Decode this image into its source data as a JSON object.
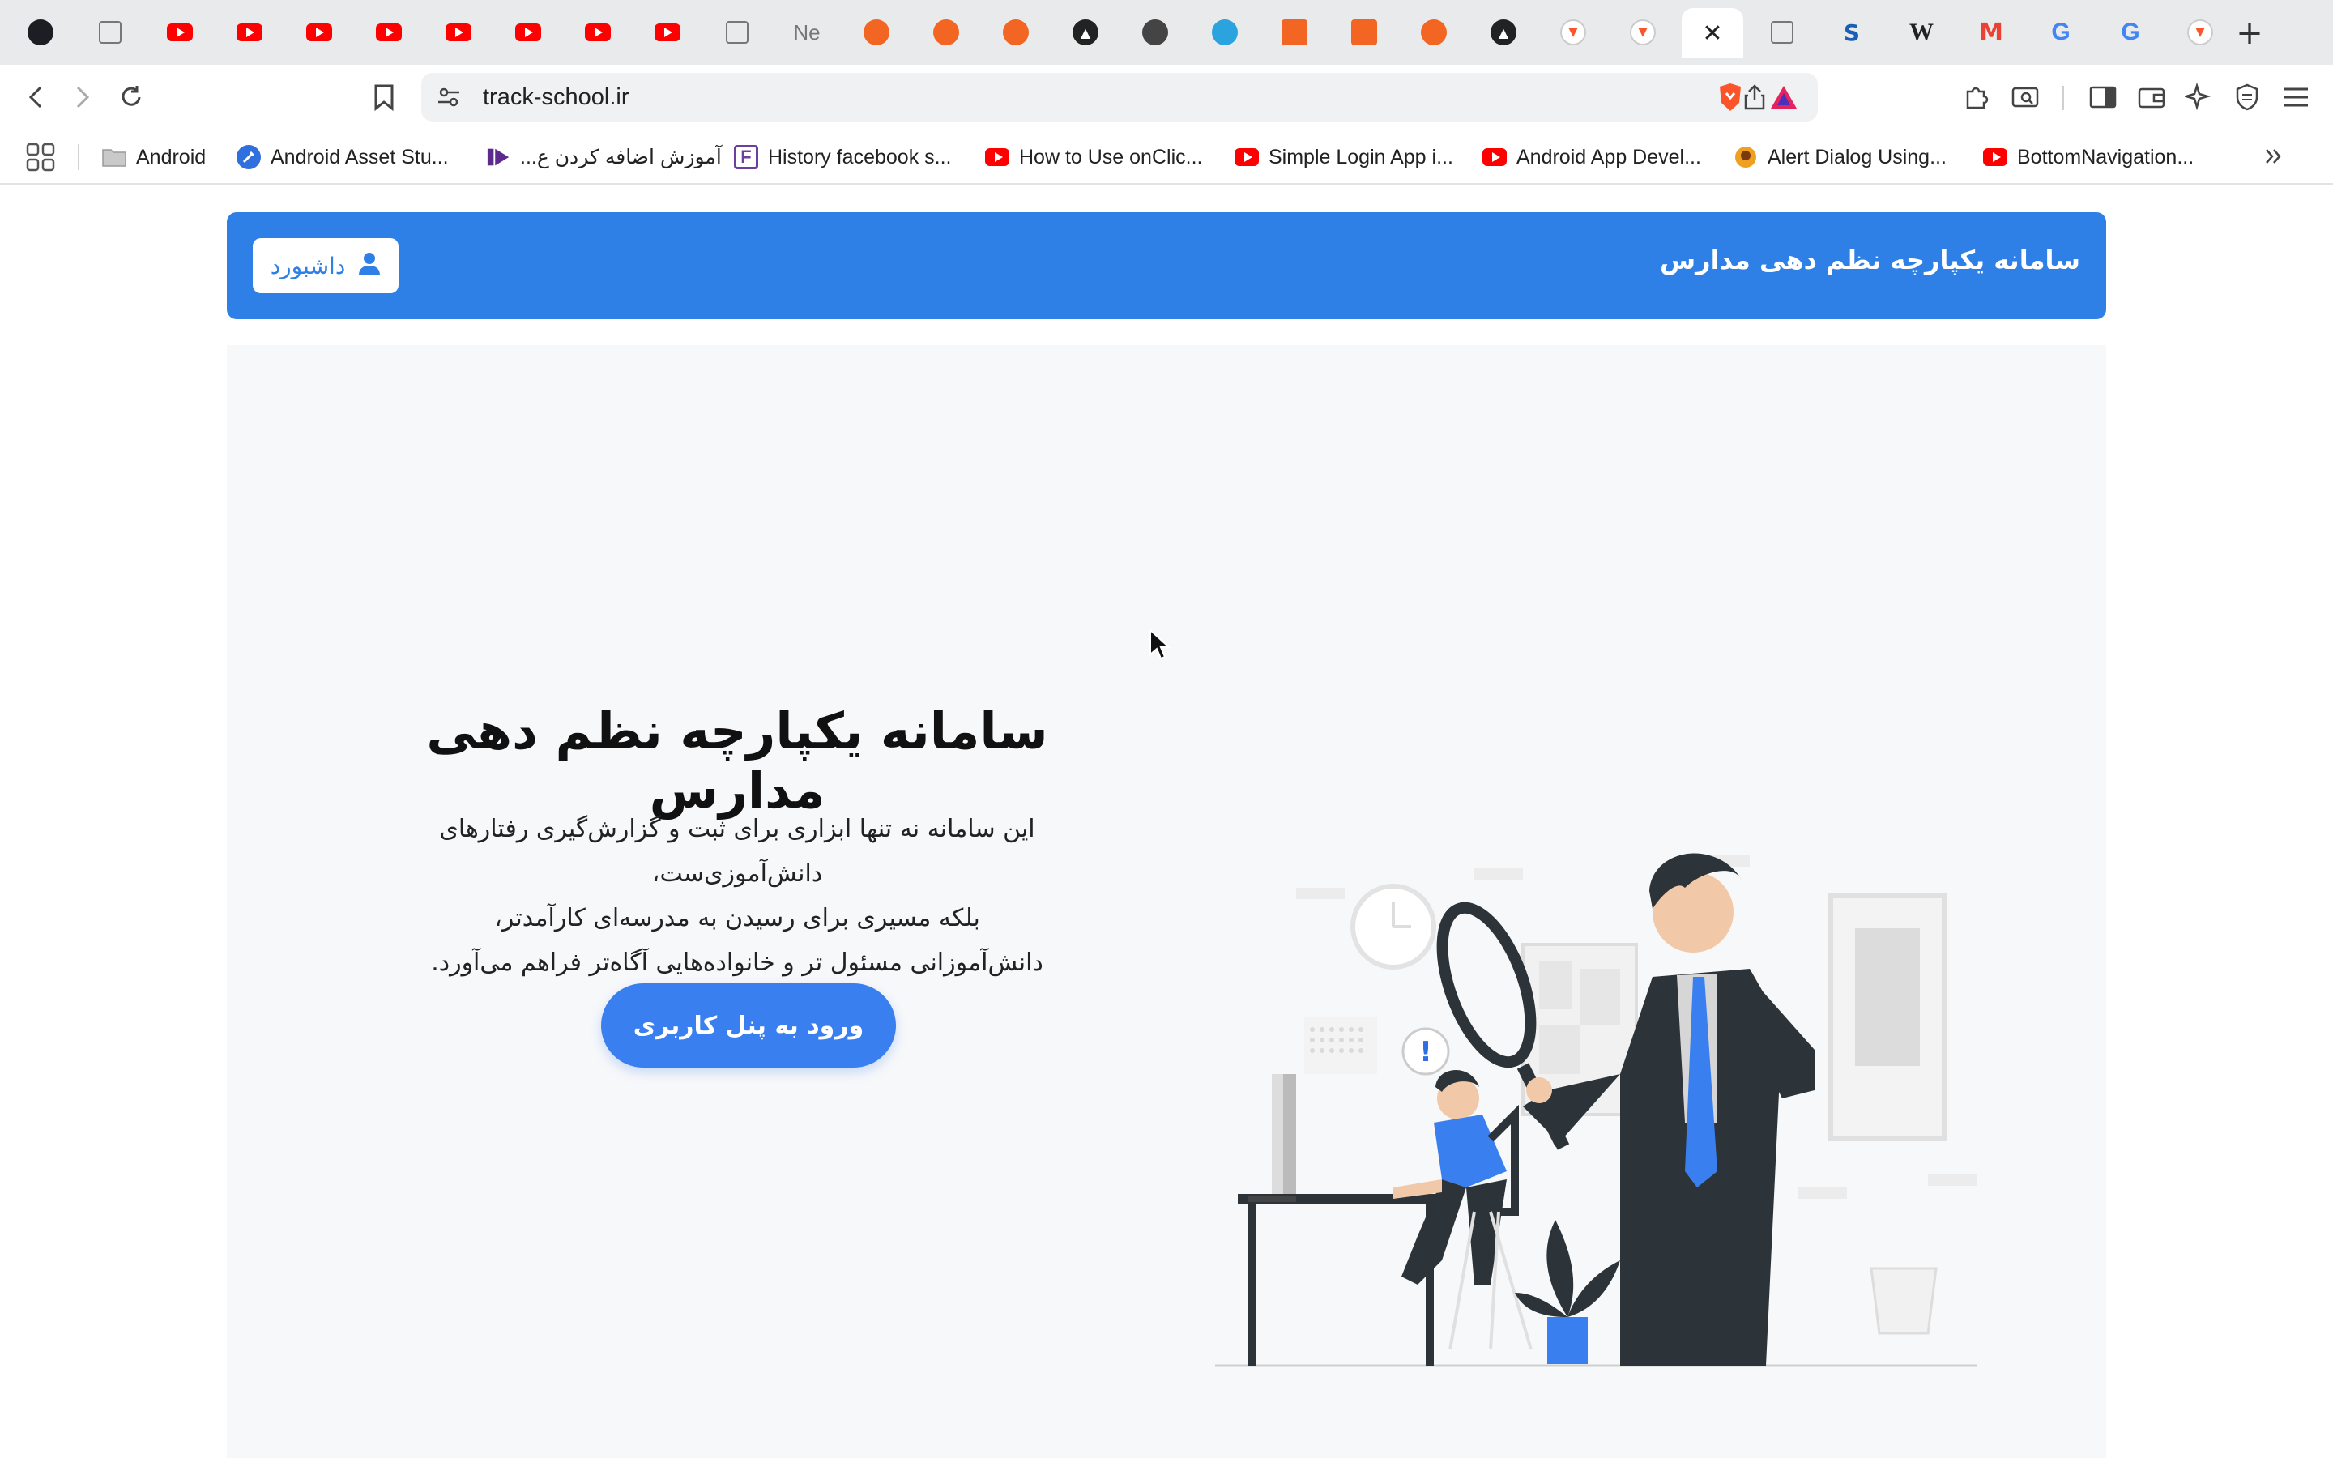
{
  "tabs": {
    "new_tab_text": "Ne",
    "active_close": "✕",
    "plus": "+",
    "items": [
      {
        "icon": "github-icon",
        "color": "#1b1f23"
      },
      {
        "icon": "reader-icon",
        "color": "#777777"
      },
      {
        "icon": "youtube-icon",
        "color": "#ff0000"
      },
      {
        "icon": "youtube-icon",
        "color": "#ff0000"
      },
      {
        "icon": "youtube-icon",
        "color": "#ff0000"
      },
      {
        "icon": "youtube-icon",
        "color": "#ff0000"
      },
      {
        "icon": "youtube-icon",
        "color": "#ff0000"
      },
      {
        "icon": "youtube-icon",
        "color": "#ff0000"
      },
      {
        "icon": "youtube-icon",
        "color": "#ff0000"
      },
      {
        "icon": "youtube-icon",
        "color": "#ff0000"
      },
      {
        "icon": "reader-icon",
        "color": "#777777"
      },
      {
        "icon": "new-tab-icon",
        "color": "#777777"
      },
      {
        "icon": "orange-site-icon",
        "color": "#f26522"
      },
      {
        "icon": "orange-site-icon",
        "color": "#f26522"
      },
      {
        "icon": "orange-site-icon",
        "color": "#f26522"
      },
      {
        "icon": "triangle-icon",
        "color": "#222222"
      },
      {
        "icon": "globe-icon",
        "color": "#444444"
      },
      {
        "icon": "telegram-icon",
        "color": "#2aa3df"
      },
      {
        "icon": "orange-square-icon",
        "color": "#f26522"
      },
      {
        "icon": "orange-square-icon",
        "color": "#f26522"
      },
      {
        "icon": "orange-site-icon",
        "color": "#f26522"
      },
      {
        "icon": "triangle-icon",
        "color": "#222222"
      },
      {
        "icon": "brave-icon",
        "color": "#fb542b"
      },
      {
        "icon": "brave-icon",
        "color": "#fb542b"
      },
      {
        "icon": "active-tab-icon",
        "color": "#ffffff"
      },
      {
        "icon": "reader-icon",
        "color": "#777777"
      },
      {
        "icon": "s-logo-icon",
        "color": "#1a5fb4"
      },
      {
        "icon": "wikipedia-icon",
        "color": "#222222"
      },
      {
        "icon": "gmail-icon",
        "color": "#ea4335"
      },
      {
        "icon": "google-icon",
        "color": "#4285f4"
      },
      {
        "icon": "google-icon",
        "color": "#4285f4"
      },
      {
        "icon": "brave-icon",
        "color": "#fb542b"
      }
    ]
  },
  "address_bar": {
    "url": "track-school.ir"
  },
  "bookmarks": [
    {
      "label": "Android",
      "icon": "folder-icon"
    },
    {
      "label": "Android Asset Stu...",
      "icon": "asset-studio-icon"
    },
    {
      "label": "آموزش اضافه کردن ع...",
      "icon": "purple-logo-icon"
    },
    {
      "label": "History facebook s...",
      "icon": "f-logo-icon"
    },
    {
      "label": "How to Use onClic...",
      "icon": "youtube-icon"
    },
    {
      "label": "Simple Login App i...",
      "icon": "youtube-icon"
    },
    {
      "label": "Android App Devel...",
      "icon": "youtube-icon"
    },
    {
      "label": "Alert Dialog Using...",
      "icon": "tutorial-icon"
    },
    {
      "label": "BottomNavigation...",
      "icon": "youtube-icon"
    }
  ],
  "site": {
    "header_title": "سامانه یکپارچه نظم دهی مدارس",
    "dashboard_label": "داشبورد",
    "hero_title": "سامانه یکپارچه نظم دهی مدارس",
    "hero_lines": [
      "این سامانه نه تنها ابزاری برای ثبت و گزارش‌گیری رفتارهای دانش‌آموزی‌ست،",
      "بلکه مسیری برای رسیدن به مدرسه‌ای کارآمدتر،",
      "دانش‌آموزانی مسئول تر و خانواده‌هایی آگاه‌تر فراهم می‌آورد."
    ],
    "cta_label": "ورود به پنل کاربری",
    "brand_color": "#2f80e6"
  }
}
